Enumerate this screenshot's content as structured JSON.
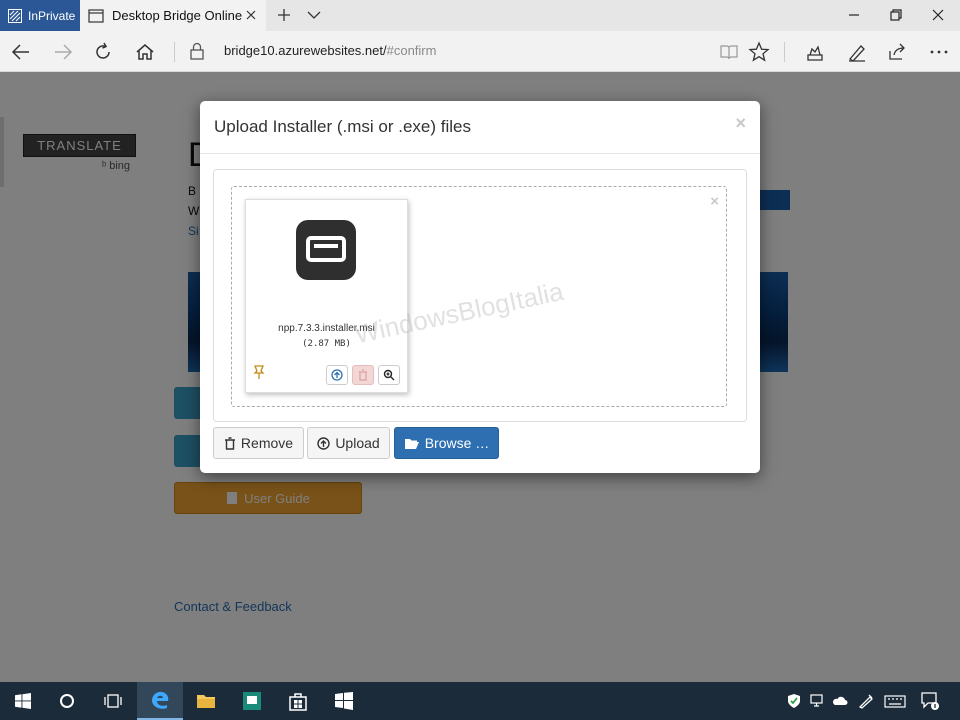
{
  "browser": {
    "inprivate_label": "InPrivate",
    "tab_title": "Desktop Bridge Online",
    "url_host": "bridge10.azurewebsites.net/",
    "url_hash": "#confirm"
  },
  "page": {
    "translate_label": "TRANSLATE",
    "bing_label": "bing",
    "heading_initial": "D",
    "line1": "B",
    "line2": "W",
    "line3": "Si",
    "user_guide_label": "User Guide",
    "contact_label": "Contact & Feedback"
  },
  "modal": {
    "title": "Upload Installer (.msi or .exe) files",
    "close_glyph": "×",
    "zone_close_glyph": "×",
    "file": {
      "name": "npp.7.3.3.installer.msi",
      "size": "(2.87 MB)"
    },
    "buttons": {
      "remove": "Remove",
      "upload": "Upload",
      "browse": "Browse …"
    }
  },
  "watermark": "WindowsBlogItalia",
  "taskbar": {
    "items": [
      "start-icon",
      "cortana-icon",
      "task-view-icon",
      "edge-icon",
      "file-explorer-icon",
      "app-icon",
      "store-icon",
      "app-icon"
    ],
    "active": "edge-icon"
  },
  "colors": {
    "inprivate": "#2b5797",
    "primary_button": "#2d6fb1",
    "user_guide": "#f0a430",
    "taskbar": "#1c2b39"
  }
}
